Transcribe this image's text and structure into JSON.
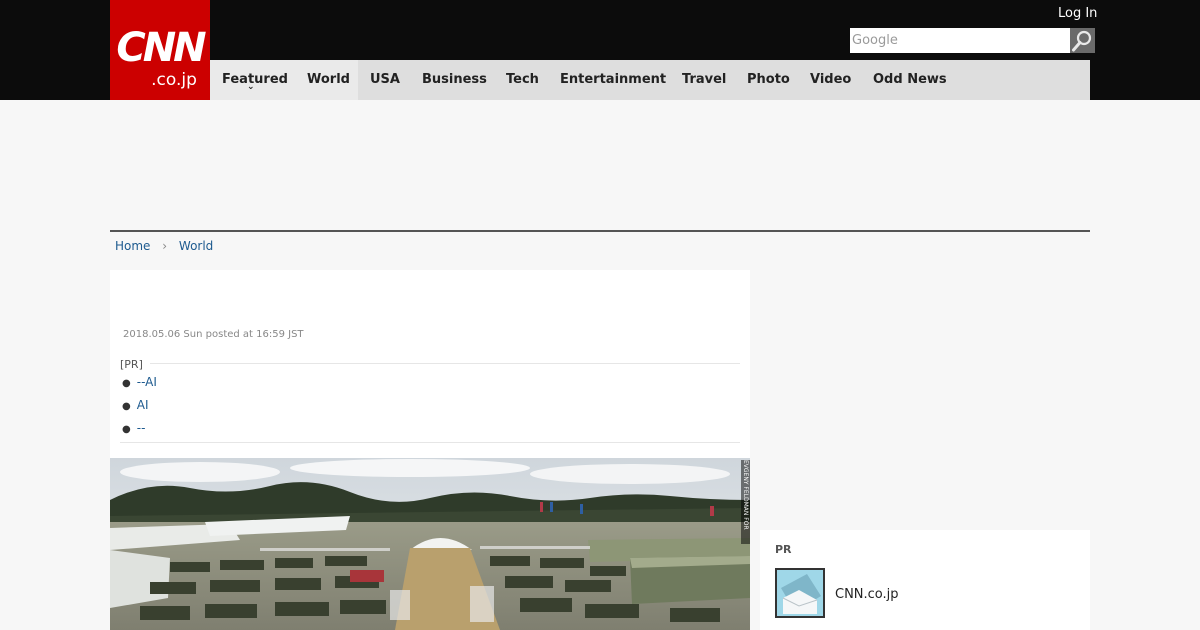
{
  "header": {
    "logo_main": "CNN",
    "logo_sub": ".co.jp",
    "login_label": "Log In",
    "search_placeholder": "Google",
    "nav": [
      {
        "label": "Featured",
        "has_dropdown": true
      },
      {
        "label": "World"
      },
      {
        "label": "USA"
      },
      {
        "label": "Business"
      },
      {
        "label": "Tech"
      },
      {
        "label": "Entertainment"
      },
      {
        "label": "Travel"
      },
      {
        "label": "Photo"
      },
      {
        "label": "Video"
      },
      {
        "label": "Odd News"
      }
    ]
  },
  "breadcrumb": {
    "items": [
      "Home",
      "World"
    ]
  },
  "article": {
    "date": "2018.05.06 Sun posted at 16:59 JST",
    "pr_label": "[PR]",
    "pr_links": [
      "--AI",
      "AI",
      "--"
    ],
    "photo_credit": "EVGENY FELDMAN FOR CNN"
  },
  "sidebar": {
    "pr_title": "PR",
    "pr_item_label": "CNN.co.jp"
  },
  "colors": {
    "brand_red": "#cc0000",
    "header_bg": "#0c0c0c",
    "nav_bg": "#dedede",
    "link": "#1d5a8f"
  }
}
